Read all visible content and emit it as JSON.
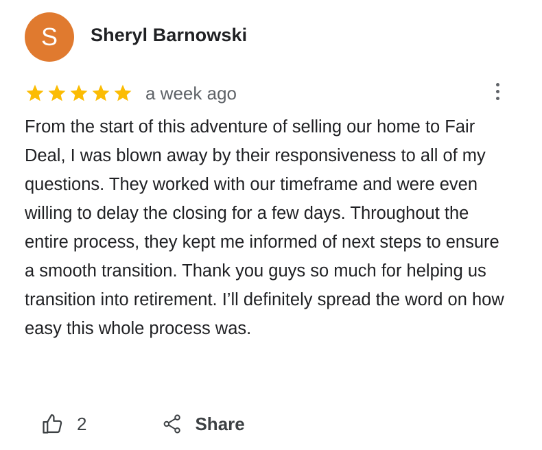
{
  "reviewer": {
    "avatar_letter": "S",
    "avatar_color": "#e07a2f",
    "name": "Sheryl Barnowski"
  },
  "review": {
    "rating": 5,
    "max_rating": 5,
    "star_color": "#fbbc04",
    "time_ago": "a week ago",
    "text": "From the start of this adventure of selling our home to Fair Deal, I was blown away by their responsiveness to all of my questions. They worked with our timeframe and were even willing to delay the closing for a few days. Throughout the entire process, they kept me informed of next steps to ensure a smooth transition. Thank you guys so much for helping us transition into retirement. I’ll definitely spread the word on how easy this whole process was."
  },
  "actions": {
    "like_icon": "thumbs-up-icon",
    "like_count": "2",
    "share_icon": "share-icon",
    "share_label": "Share",
    "more_icon": "more-vert-icon"
  }
}
